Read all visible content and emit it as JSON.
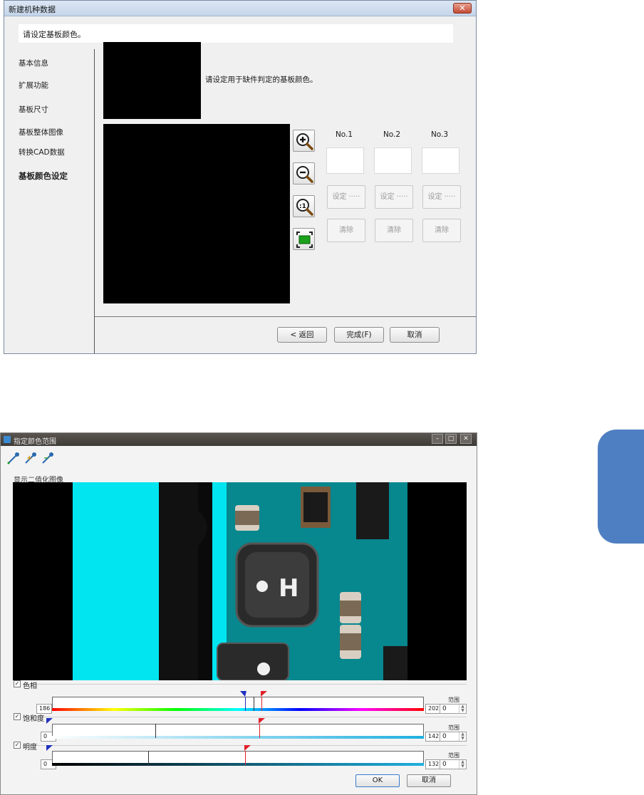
{
  "dialog1": {
    "title": "新建机种数据",
    "close_label": "✕",
    "instruction": "请设定基板颜色。",
    "description": "请设定用于缺件判定的基板颜色。",
    "nav_items": [
      "基本信息",
      "扩展功能",
      "基板尺寸",
      "基板整体图像",
      "转换CAD数据",
      "基板颜色设定"
    ],
    "active_nav": "基板颜色设定",
    "tools": [
      "zoom-in-icon",
      "zoom-out-icon",
      "zoom-1x-icon",
      "fit-window-icon"
    ],
    "color_slots": [
      {
        "label": "No.1",
        "set": "设定 ·····",
        "clear": "清除"
      },
      {
        "label": "No.2",
        "set": "设定 ·····",
        "clear": "清除"
      },
      {
        "label": "No.3",
        "set": "设定 ·····",
        "clear": "清除"
      }
    ],
    "buttons": {
      "back": "<  返回",
      "finish": "完成(F)",
      "cancel": "取消"
    }
  },
  "dialog2": {
    "title": "指定颜色范围",
    "pipettes": [
      "pipette-icon",
      "pipette-add-icon",
      "pipette-remove-icon"
    ],
    "binary_label": "显示二值化图像",
    "preview_text": "H",
    "sliders": [
      {
        "label": "色相",
        "checked": true,
        "min": "186",
        "max": "202",
        "range_label": "范围",
        "range_value": "0"
      },
      {
        "label": "饱和度",
        "checked": true,
        "min": "0",
        "max": "142",
        "range_label": "范围",
        "range_value": "0"
      },
      {
        "label": "明度",
        "checked": true,
        "min": "0",
        "max": "132",
        "range_label": "范围",
        "range_value": "0"
      }
    ],
    "buttons": {
      "ok": "OK",
      "cancel": "取消"
    }
  },
  "colors": {
    "binary_cyan": "#00e5f0",
    "side_tab": "#4e7fc2",
    "accent_red": "#e0202a",
    "accent_blue": "#2030c0"
  }
}
